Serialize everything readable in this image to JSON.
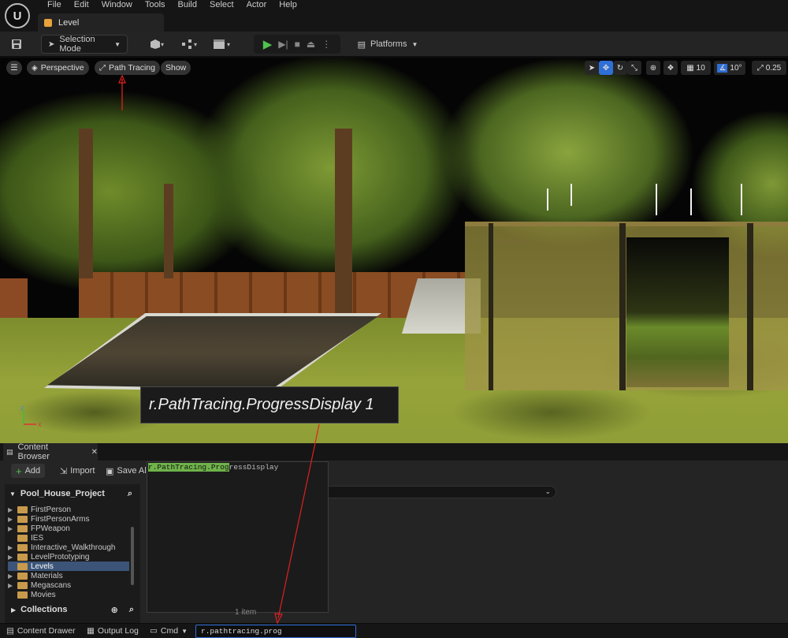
{
  "menu": {
    "items": [
      "File",
      "Edit",
      "Window",
      "Tools",
      "Build",
      "Select",
      "Actor",
      "Help"
    ],
    "level_tab": "Level"
  },
  "toolbar": {
    "selection_mode": "Selection Mode",
    "platforms": "Platforms"
  },
  "viewport": {
    "perspective": "Perspective",
    "path_tracing": "Path Tracing",
    "show": "Show",
    "grid_snap": "10",
    "rotation_snap": "10°",
    "scale_snap": "0.25",
    "console_tooltip": "r.PathTracing.ProgressDisplay 1"
  },
  "content_browser": {
    "tab_label": "Content Browser",
    "add": "Add",
    "import": "Import",
    "save_all": "Save All",
    "project": "Pool_House_Project",
    "folders": [
      {
        "label": "FirstPerson",
        "expandable": true,
        "selected": false
      },
      {
        "label": "FirstPersonArms",
        "expandable": true,
        "selected": false
      },
      {
        "label": "FPWeapon",
        "expandable": true,
        "selected": false
      },
      {
        "label": "IES",
        "expandable": false,
        "selected": false
      },
      {
        "label": "Interactive_Walkthrough",
        "expandable": true,
        "selected": false
      },
      {
        "label": "LevelPrototyping",
        "expandable": true,
        "selected": false
      },
      {
        "label": "Levels",
        "expandable": false,
        "selected": true
      },
      {
        "label": "Materials",
        "expandable": true,
        "selected": false
      },
      {
        "label": "Megascans",
        "expandable": true,
        "selected": false
      },
      {
        "label": "Movies",
        "expandable": false,
        "selected": false
      }
    ],
    "collections": "Collections",
    "autocomplete": {
      "highlighted": "r.PathTracing.Prog",
      "rest": "ressDisplay"
    },
    "items_label": "1 item"
  },
  "statusbar": {
    "content_drawer": "Content Drawer",
    "output_log": "Output Log",
    "cmd": "Cmd",
    "cmd_value": "r.pathtracing.prog"
  },
  "colors": {
    "annotation": "#e02020",
    "selection_blue": "#3b5478",
    "accent_blue": "#2f6fd6",
    "autocomplete_highlight": "#6fb34a"
  }
}
